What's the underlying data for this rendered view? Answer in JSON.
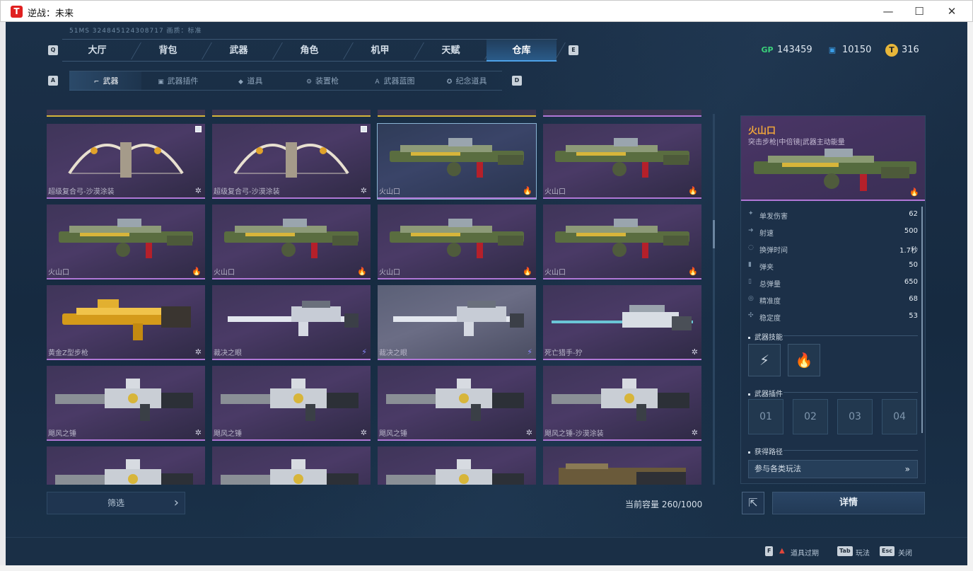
{
  "window": {
    "title": "逆战：未来",
    "minimize": "—",
    "maximize": "☐",
    "close": "✕"
  },
  "server_info": "51MS  324845124308717    画质：标准",
  "key_hints": {
    "q": "Q",
    "e": "E",
    "a": "A",
    "d": "D"
  },
  "main_tabs": [
    {
      "label": "大厅"
    },
    {
      "label": "背包"
    },
    {
      "label": "武器"
    },
    {
      "label": "角色"
    },
    {
      "label": "机甲"
    },
    {
      "label": "天赋"
    },
    {
      "label": "仓库",
      "active": true
    }
  ],
  "currencies": [
    {
      "icon": "gp-icon",
      "symbol": "GP",
      "value": "143459",
      "color": "#3ad07a"
    },
    {
      "icon": "ticket-icon",
      "symbol": "▣",
      "value": "10150",
      "color": "#3a9ee8"
    },
    {
      "icon": "coin-icon",
      "symbol": "T",
      "value": "316",
      "color": "#e8b73a"
    }
  ],
  "sub_tabs": [
    {
      "label": "武器",
      "icon": "rifle-icon",
      "glyph": "⌐",
      "active": true
    },
    {
      "label": "武器插件",
      "icon": "plugin-icon",
      "glyph": "▣"
    },
    {
      "label": "道具",
      "icon": "item-icon",
      "glyph": "◆"
    },
    {
      "label": "装置枪",
      "icon": "device-gun-icon",
      "glyph": "⚙"
    },
    {
      "label": "武器蓝图",
      "icon": "blueprint-icon",
      "glyph": "A"
    },
    {
      "label": "纪念道具",
      "icon": "souvenir-icon",
      "glyph": "✪"
    }
  ],
  "grid": {
    "cards": [
      {
        "name": "超级复合弓-沙漠涂装",
        "badge": "✲",
        "badge_icon": "star-badge-icon",
        "kind": "bow",
        "checkbox": true
      },
      {
        "name": "超级复合弓-沙漠涂装",
        "badge": "✲",
        "badge_icon": "star-badge-icon",
        "kind": "bow",
        "checkbox": true
      },
      {
        "name": "火山口",
        "badge": "🔥",
        "badge_icon": "fire-badge-icon",
        "kind": "rifle",
        "selected": true
      },
      {
        "name": "火山口",
        "badge": "🔥",
        "badge_icon": "fire-badge-icon",
        "kind": "rifle"
      },
      {
        "name": "火山口",
        "badge": "🔥",
        "badge_icon": "fire-badge-icon",
        "kind": "rifle"
      },
      {
        "name": "火山口",
        "badge": "🔥",
        "badge_icon": "fire-badge-icon",
        "kind": "rifle"
      },
      {
        "name": "火山口",
        "badge": "🔥",
        "badge_icon": "fire-badge-icon",
        "kind": "rifle"
      },
      {
        "name": "火山口",
        "badge": "🔥",
        "badge_icon": "fire-badge-icon",
        "kind": "rifle"
      },
      {
        "name": "黄金Z型步枪",
        "badge": "✲",
        "badge_icon": "star-badge-icon",
        "kind": "gold"
      },
      {
        "name": "裁决之眼",
        "badge": "⚡",
        "badge_icon": "lightning-badge-icon",
        "kind": "sniper"
      },
      {
        "name": "裁决之眼",
        "badge": "⚡",
        "badge_icon": "lightning-badge-icon",
        "kind": "sniper",
        "hover": true
      },
      {
        "name": "死亡猎手-狞",
        "badge": "✲",
        "badge_icon": "star-badge-icon",
        "kind": "long"
      },
      {
        "name": "飓风之锤",
        "badge": "✲",
        "badge_icon": "star-badge-icon",
        "kind": "minigun"
      },
      {
        "name": "飓风之锤",
        "badge": "✲",
        "badge_icon": "star-badge-icon",
        "kind": "minigun"
      },
      {
        "name": "飓风之锤",
        "badge": "✲",
        "badge_icon": "star-badge-icon",
        "kind": "minigun"
      },
      {
        "name": "飓风之锤-沙漠涂装",
        "badge": "✲",
        "badge_icon": "star-badge-icon",
        "kind": "minigun"
      },
      {
        "name": "",
        "badge": "",
        "kind": "minigun"
      },
      {
        "name": "",
        "badge": "",
        "kind": "minigun"
      },
      {
        "name": "",
        "badge": "",
        "kind": "minigun"
      },
      {
        "name": "",
        "badge": "",
        "kind": "cannon"
      }
    ]
  },
  "filter_label": "筛选",
  "filter_arrow": "›",
  "capacity": "当前容量 260/1000",
  "detail": {
    "name": "火山口",
    "type": "突击步枪|中倍镜|武器主动能量",
    "badge": "🔥",
    "stats": [
      {
        "label": "单发伤害",
        "value": "62",
        "icon": "damage-icon",
        "glyph": "✦"
      },
      {
        "label": "射速",
        "value": "500",
        "icon": "firerate-icon",
        "glyph": "➜"
      },
      {
        "label": "换弹时间",
        "value": "1.7秒",
        "icon": "reload-icon",
        "glyph": "◌"
      },
      {
        "label": "弹夹",
        "value": "50",
        "icon": "magazine-icon",
        "glyph": "▮"
      },
      {
        "label": "总弹量",
        "value": "650",
        "icon": "ammo-icon",
        "glyph": "▯"
      },
      {
        "label": "精准度",
        "value": "68",
        "icon": "accuracy-icon",
        "glyph": "◎"
      },
      {
        "label": "稳定度",
        "value": "53",
        "icon": "stability-icon",
        "glyph": "✣"
      }
    ],
    "skills_title": "武器技能",
    "skills": [
      {
        "icon": "energy-skill-icon",
        "glyph": "⚡"
      },
      {
        "icon": "flame-skill-icon",
        "glyph": "🔥"
      }
    ],
    "plugins_title": "武器插件",
    "plugin_slots": [
      "01",
      "02",
      "03",
      "04"
    ],
    "source_title": "获得路径",
    "source": "参与各类玩法",
    "source_arrow": "»"
  },
  "share_glyph": "⇱",
  "details_button": "详情",
  "footer": [
    {
      "key": "F",
      "label": "道具过期",
      "warn": "▲"
    },
    {
      "key": "Tab",
      "label": "玩法"
    },
    {
      "key": "Esc",
      "label": "关闭"
    }
  ]
}
